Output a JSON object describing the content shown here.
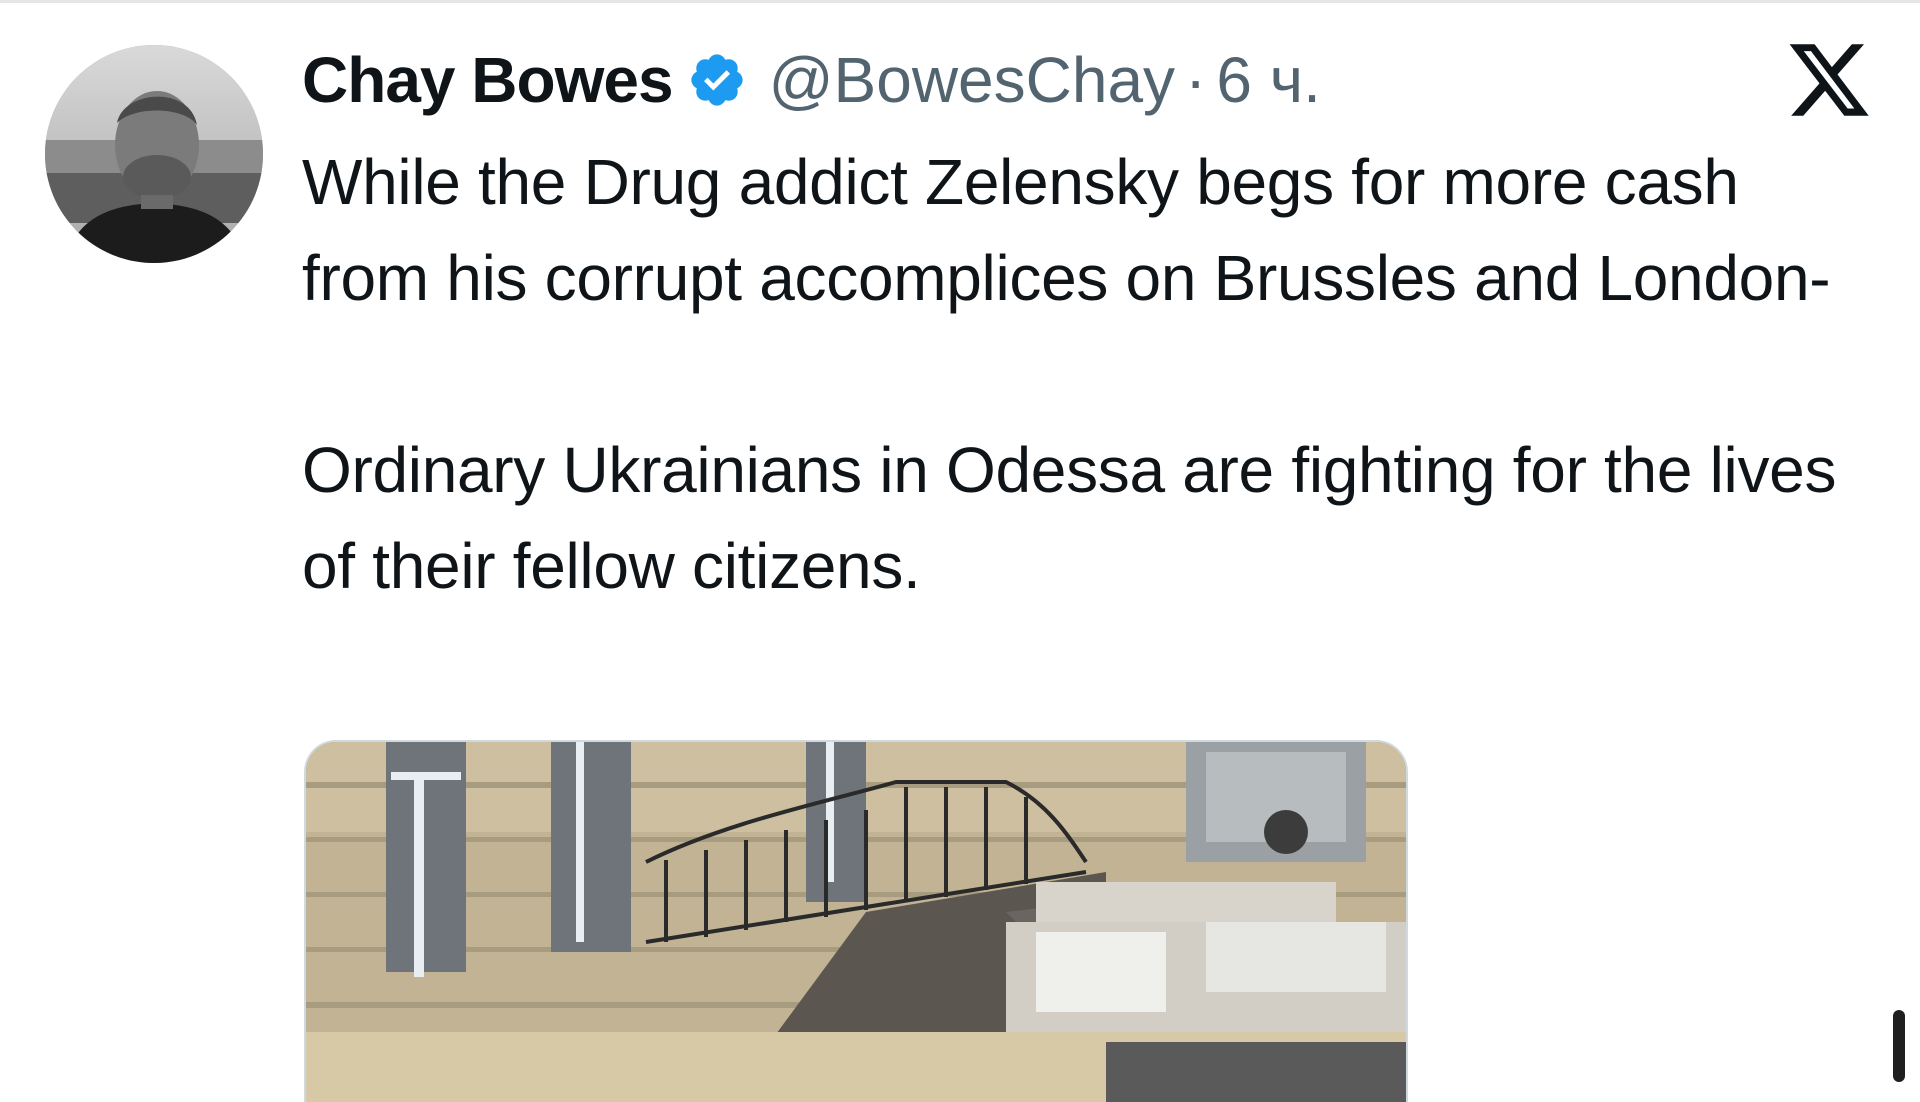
{
  "tweet": {
    "display_name": "Chay Bowes",
    "handle": "@BowesChay",
    "separator": "·",
    "time": "6 ч.",
    "paragraphs": [
      "While the Drug addict Zelensky begs for more cash from his corrupt accomplices on Brussles and London-",
      "Ordinary Ukrainians in Odessa are fighting for the lives of their fellow citizens."
    ]
  },
  "icons": {
    "verified": "verified-badge-icon",
    "platform": "x-logo-icon"
  },
  "colors": {
    "verified_blue": "#1d9bf0",
    "text_primary": "#0f1419",
    "text_secondary": "#536471"
  }
}
